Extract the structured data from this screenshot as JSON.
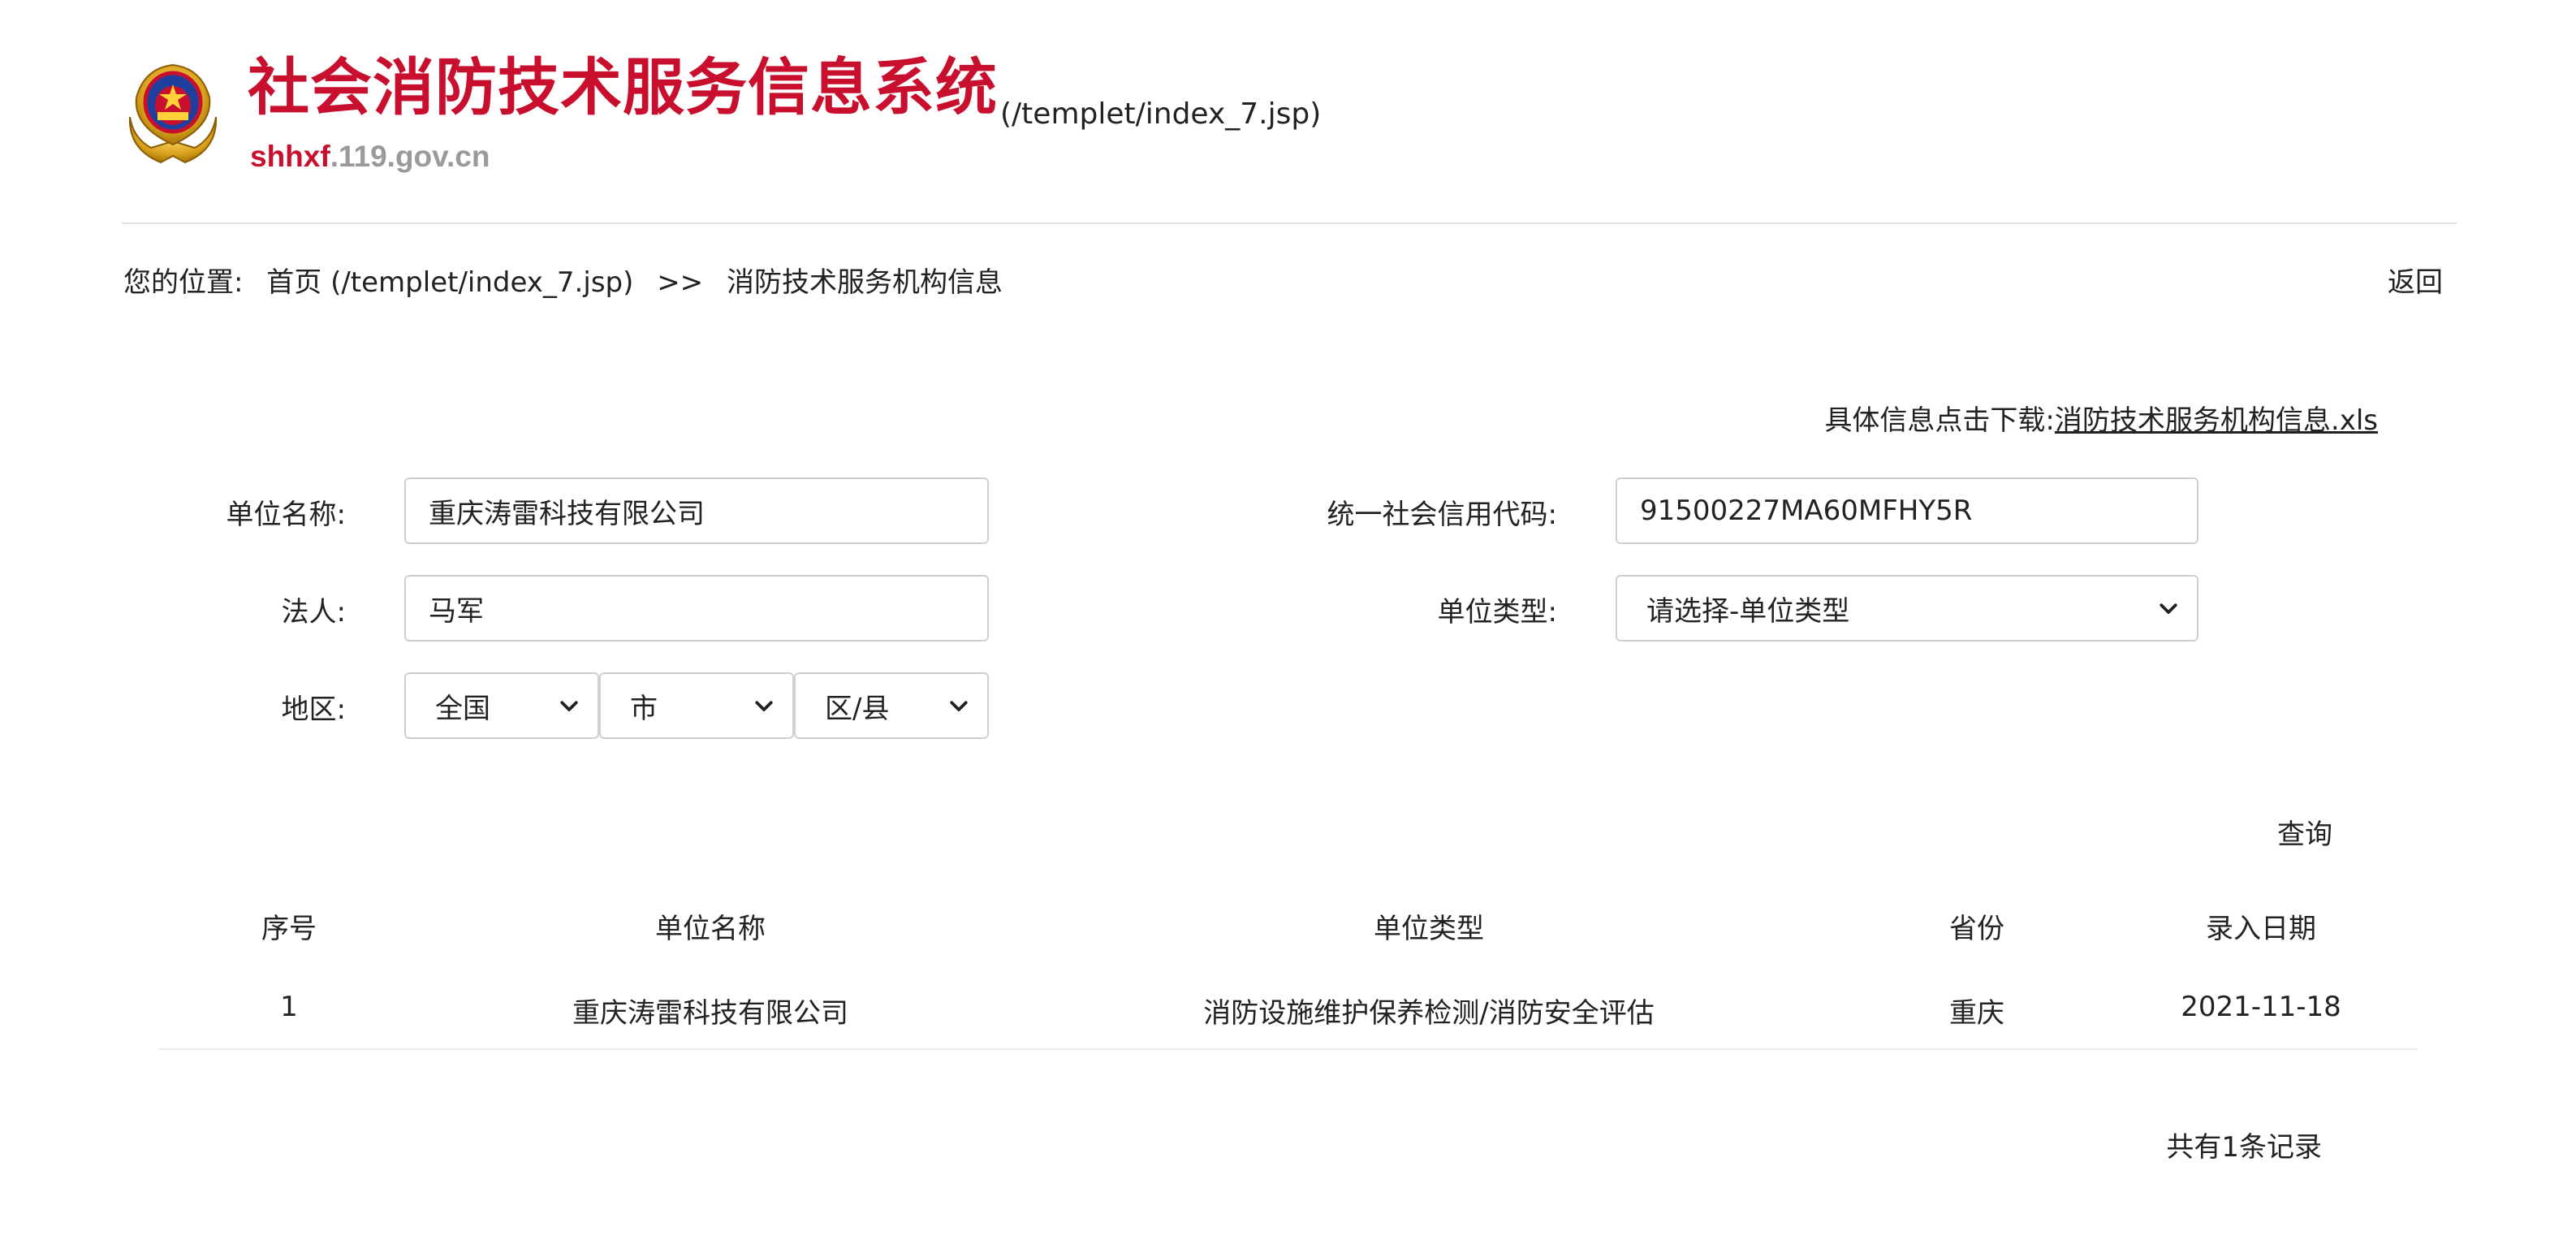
{
  "header": {
    "site_title": "社会消防技术服务信息系统",
    "title_link": "(/templet/index_7.jsp)",
    "domain_part1": "shhxf",
    "domain_part2": ".119.gov.cn"
  },
  "breadcrumb": {
    "prefix": "您的位置:",
    "home": "首页 (/templet/index_7.jsp)",
    "separator": ">>",
    "current": "消防技术服务机构信息",
    "back": "返回"
  },
  "download": {
    "label": "具体信息点击下载:",
    "link": "消防技术服务机构信息.xls"
  },
  "form": {
    "unit_name_label": "单位名称:",
    "unit_name_value": "重庆涛雷科技有限公司",
    "credit_code_label": "统一社会信用代码:",
    "credit_code_value": "91500227MA60MFHY5R",
    "legal_person_label": "法人:",
    "legal_person_value": "马军",
    "unit_type_label": "单位类型:",
    "unit_type_value": "请选择-单位类型",
    "region_label": "地区:",
    "province_value": "全国",
    "city_value": "市",
    "district_value": "区/县",
    "query_button": "查询"
  },
  "table": {
    "headers": [
      "序号",
      "单位名称",
      "单位类型",
      "省份",
      "录入日期"
    ],
    "rows": [
      [
        "1",
        "重庆涛雷科技有限公司",
        "消防设施维护保养检测/消防安全评估",
        "重庆",
        "2021-11-18"
      ]
    ]
  },
  "footer": {
    "record_count": "共有1条记录"
  },
  "colors": {
    "brand_red": "#c8102e",
    "domain_gray": "#9a9a9a",
    "border": "#cfcfcf"
  },
  "icons": {
    "emblem": "fire-rescue-emblem-icon",
    "dropdown": "chevron-down-icon"
  }
}
